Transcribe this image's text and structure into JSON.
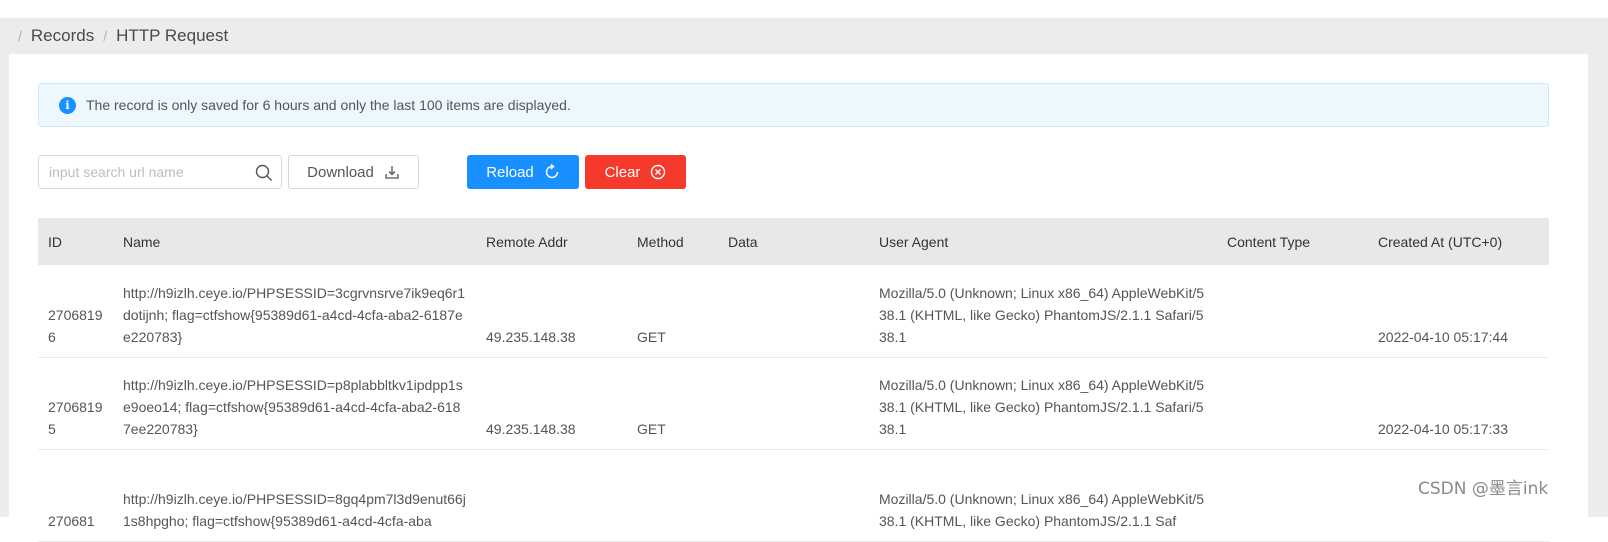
{
  "breadcrumb": {
    "separator": "/",
    "items": [
      "Records",
      "HTTP Request"
    ]
  },
  "alert": {
    "text": "The record is only saved for 6 hours and only the last 100 items are displayed."
  },
  "search": {
    "placeholder": "input search url name",
    "value": ""
  },
  "toolbar": {
    "download_label": "Download",
    "reload_label": "Reload",
    "clear_label": "Clear"
  },
  "colors": {
    "primary": "#1890ff",
    "danger": "#f5392b",
    "alert_bg": "#ecf7fe"
  },
  "table": {
    "headers": [
      "ID",
      "Name",
      "Remote Addr",
      "Method",
      "Data",
      "User Agent",
      "Content Type",
      "Created At (UTC+0)"
    ],
    "rows": [
      {
        "id": "27068196",
        "name": "http://h9izlh.ceye.io/PHPSESSID=3cgrvnsrve7ik9eq6r1dotijnh; flag=ctfshow{95389d61-a4cd-4cfa-aba2-6187ee220783}",
        "remote_addr": "49.235.148.38",
        "method": "GET",
        "data": "",
        "user_agent": "Mozilla/5.0 (Unknown; Linux x86_64) AppleWebKit/538.1 (KHTML, like Gecko) PhantomJS/2.1.1 Safari/538.1",
        "content_type": "",
        "created_at": "2022-04-10 05:17:44"
      },
      {
        "id": "27068195",
        "name": "http://h9izlh.ceye.io/PHPSESSID=p8plabbltkv1ipdpp1se9oeo14; flag=ctfshow{95389d61-a4cd-4cfa-aba2-6187ee220783}",
        "remote_addr": "49.235.148.38",
        "method": "GET",
        "data": "",
        "user_agent": "Mozilla/5.0 (Unknown; Linux x86_64) AppleWebKit/538.1 (KHTML, like Gecko) PhantomJS/2.1.1 Safari/538.1",
        "content_type": "",
        "created_at": "2022-04-10 05:17:33"
      },
      {
        "id": "270681",
        "name": "http://h9izlh.ceye.io/PHPSESSID=8gq4pm7l3d9enut66j1s8hpgho; flag=ctfshow{95389d61-a4cd-4cfa-aba",
        "remote_addr": "",
        "method": "",
        "data": "",
        "user_agent": "Mozilla/5.0 (Unknown; Linux x86_64) AppleWebKit/538.1 (KHTML, like Gecko) PhantomJS/2.1.1 Saf",
        "content_type": "",
        "created_at": ""
      }
    ]
  },
  "watermark": "CSDN @墨言ink"
}
